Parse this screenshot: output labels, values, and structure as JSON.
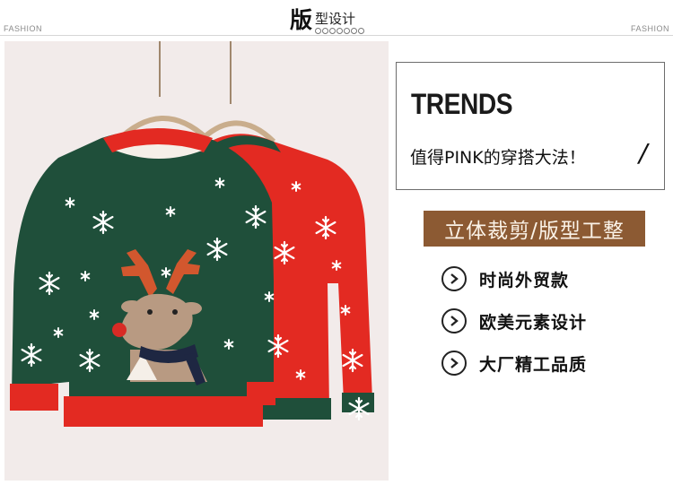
{
  "header": {
    "fashion_left": "FASHION",
    "fashion_right": "FASHION",
    "title_big": "版",
    "title_small": "型设计"
  },
  "trends": {
    "title": "TRENDS",
    "subtitle": "值得PINK的穿搭大法！"
  },
  "banner": {
    "text": "立体裁剪/版型工整",
    "color": "#8c5a33"
  },
  "features": [
    {
      "label": "时尚外贸款",
      "icon": "chevron-right-circle-icon"
    },
    {
      "label": "欧美元素设计",
      "icon": "chevron-right-circle-icon"
    },
    {
      "label": "大厂精工品质",
      "icon": "chevron-right-circle-icon"
    }
  ],
  "colors": {
    "sweater_green": "#1f4f3a",
    "sweater_red": "#e32a22",
    "background": "#f2ebea"
  }
}
